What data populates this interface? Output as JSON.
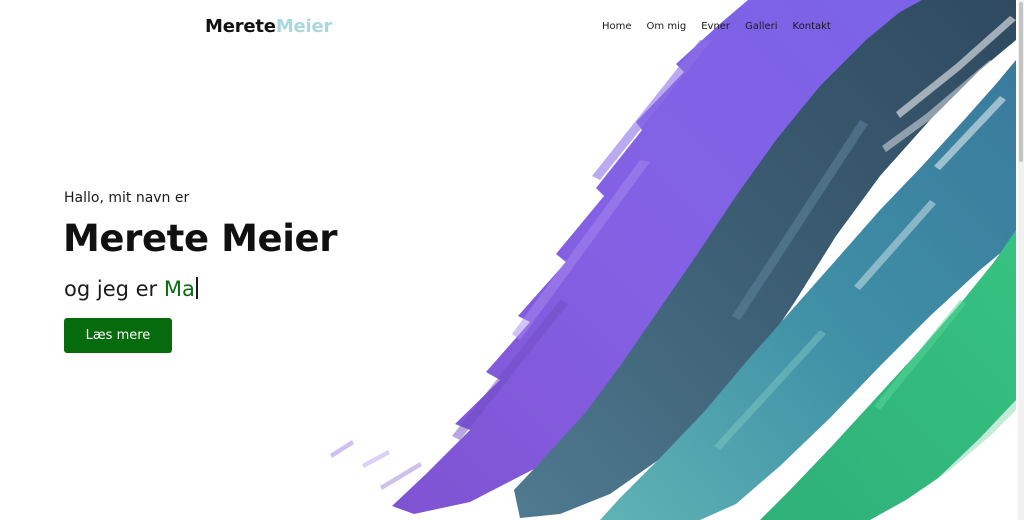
{
  "logo": {
    "first": "Merete",
    "last": "Meier"
  },
  "nav": {
    "items": [
      {
        "label": "Home"
      },
      {
        "label": "Om mig"
      },
      {
        "label": "Evner"
      },
      {
        "label": "Galleri"
      },
      {
        "label": "Kontakt"
      }
    ]
  },
  "hero": {
    "greeting": "Hallo, mit navn er",
    "name": "Merete Meier",
    "tagline_prefix": "og jeg er",
    "typed_text": "Ma",
    "button_label": "Læs mere"
  },
  "colors": {
    "logo_dark": "#121212",
    "logo_accent": "#a9d8df",
    "typed_accent": "#0a6b14",
    "button_bg": "#056b0d",
    "stroke_purple": "#7f5ee3",
    "stroke_slate": "#3f5e74",
    "stroke_teal": "#3d87a0",
    "stroke_green": "#2fb579"
  }
}
